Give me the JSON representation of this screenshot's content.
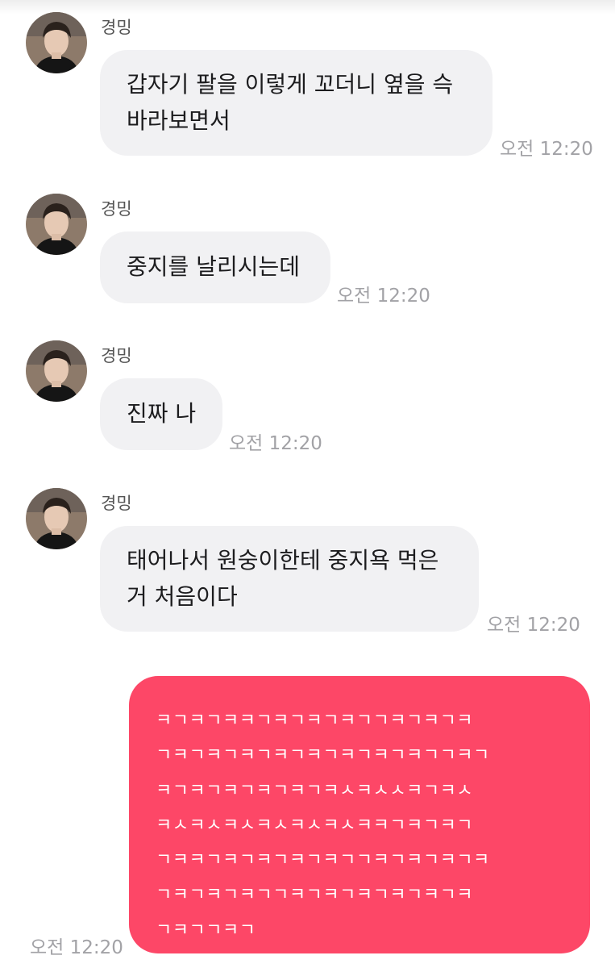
{
  "colors": {
    "received_bubble": "#f1f1f3",
    "sent_bubble": "#fd4767",
    "timestamp": "#a2a2a6",
    "sender_name": "#555555"
  },
  "messages": [
    {
      "sender": "경밍",
      "avatar": "profile-photo",
      "lines": [
        "갑자기 팔을 이렇게 꼬더니 옆을 슥",
        "바라보면서"
      ],
      "time": "오전 12:20"
    },
    {
      "sender": "경밍",
      "avatar": "profile-photo",
      "lines": [
        "중지를 날리시는데"
      ],
      "time": "오전 12:20"
    },
    {
      "sender": "경밍",
      "avatar": "profile-photo",
      "lines": [
        "진짜 나"
      ],
      "time": "오전 12:20"
    },
    {
      "sender": "경밍",
      "avatar": "profile-photo",
      "lines": [
        "태어나서 원숭이한테 중지욕 먹은",
        "거 처음이다"
      ],
      "time": "오전 12:20"
    }
  ],
  "sent_message": {
    "lines": [
      "ㅋㄱㅋㄱㅋㅋㄱㅋㄱㅋㄱㅋㄱㄱㅋㄱㅋㄱㅋ",
      "ㄱㅋㄱㅋㄱㅋㄱㅋㄱㅋㄱㅋㄱㅋㄱㅋㄱㄱㅋㄱ",
      "ㅋㄱㅋㄱㅋㄱㅋㄱㅋㄱㅋㅅㅋㅅㅅㅋㄱㅋㅅ",
      "ㅋㅅㅋㅅㅋㅅㅋㅅㅋㅅㅋㅅㅋㅋㄱㅋㄱㅋㄱ",
      "ㄱㅋㅋㄱㅋㄱㅋㄱㅋㄱㅋㄱㄱㅋㄱㅋㄱㅋㄱㅋ",
      "ㄱㅋㄱㅋㄱㅋㄱㄱㅋㄱㅋㄱㅋㄱㅋㄱㅋㄱㅋ",
      "ㄱㅋㄱㄱㅋㄱ"
    ],
    "time": "오전 12:20"
  }
}
